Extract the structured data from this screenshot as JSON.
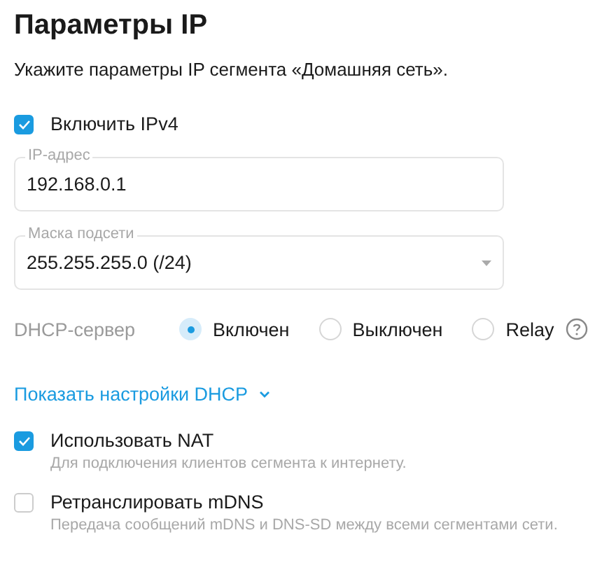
{
  "title": "Параметры IP",
  "subtitle": "Укажите параметры IP сегмента «Домашняя сеть».",
  "ipv4": {
    "label": "Включить IPv4",
    "checked": true
  },
  "ip_field": {
    "label": "IP-адрес",
    "value": "192.168.0.1"
  },
  "mask_field": {
    "label": "Маска подсети",
    "value": "255.255.255.0 (/24)"
  },
  "dhcp": {
    "label": "DHCP-сервер",
    "options": [
      {
        "label": "Включен",
        "selected": true
      },
      {
        "label": "Выключен",
        "selected": false
      },
      {
        "label": "Relay",
        "selected": false
      }
    ]
  },
  "dhcp_link": {
    "label": "Показать настройки DHCP",
    "expanded": false
  },
  "options": [
    {
      "label": "Использовать NAT",
      "description": "Для подключения клиентов сегмента к интернету.",
      "checked": true
    },
    {
      "label": "Ретранслировать mDNS",
      "description": "Передача сообщений mDNS и DNS-SD между всеми сегментами сети.",
      "checked": false
    }
  ]
}
